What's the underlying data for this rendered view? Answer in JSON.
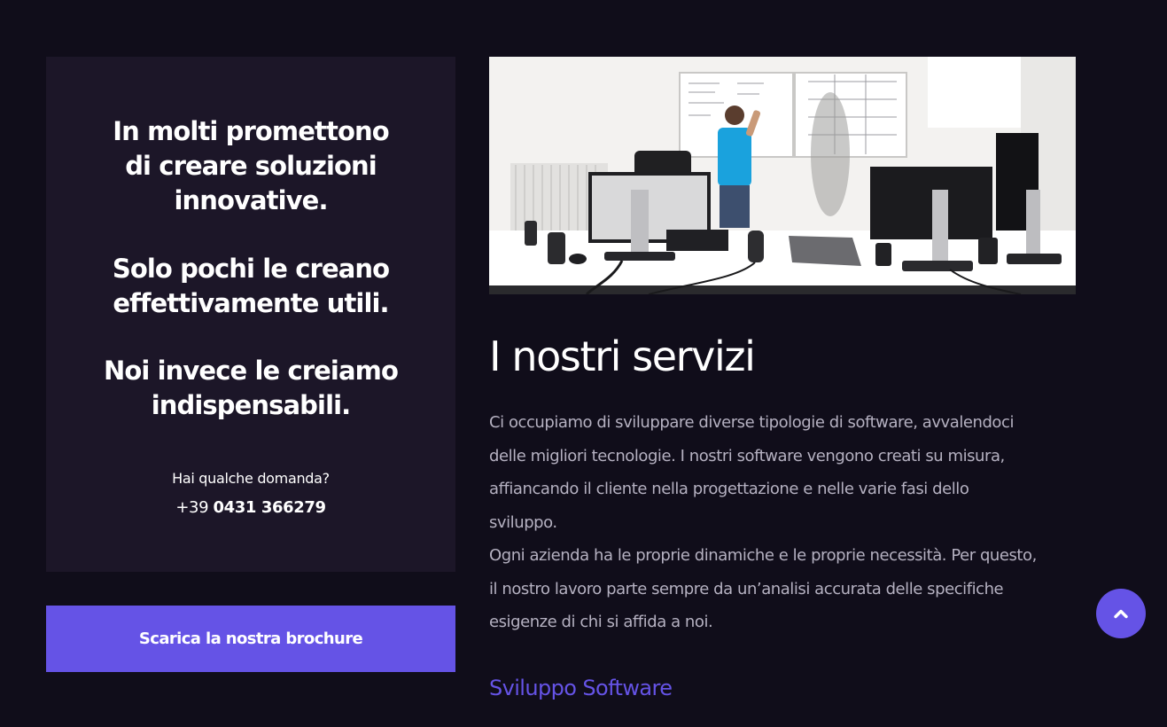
{
  "sidebar": {
    "tagline_1": [
      "In molti promettono",
      "di creare soluzioni",
      "innovative."
    ],
    "tagline_2": [
      "Solo pochi le creano",
      "effettivamente utili."
    ],
    "tagline_3": [
      "Noi invece le creiamo",
      "indispensabili."
    ],
    "contact_question": "Hai qualche domanda?",
    "phone_prefix": "+39",
    "phone_number": "0431 366279",
    "brochure_button_label": "Scarica la nostra brochure"
  },
  "main": {
    "heading": "I nostri servizi",
    "paragraph_lines": [
      "Ci occupiamo di sviluppare diverse tipologie di software, avvalendoci",
      "delle migliori tecnologie. I nostri software vengono creati su misura,",
      "affiancando il cliente nella progettazione e nelle varie fasi dello",
      "sviluppo.",
      "Ogni azienda ha le proprie dinamiche e le proprie necessità. Per questo,",
      "il nostro lavoro parte sempre da un’analisi accurata delle specifiche",
      "esigenze di chi si affida a noi."
    ],
    "subheading": "Sviluppo Software"
  },
  "icons": {
    "scroll_top": "chevron-up-icon"
  },
  "colors": {
    "background": "#100d1a",
    "panel": "#1c1628",
    "accent": "#6553e6",
    "body_text": "#b5b1c1"
  }
}
